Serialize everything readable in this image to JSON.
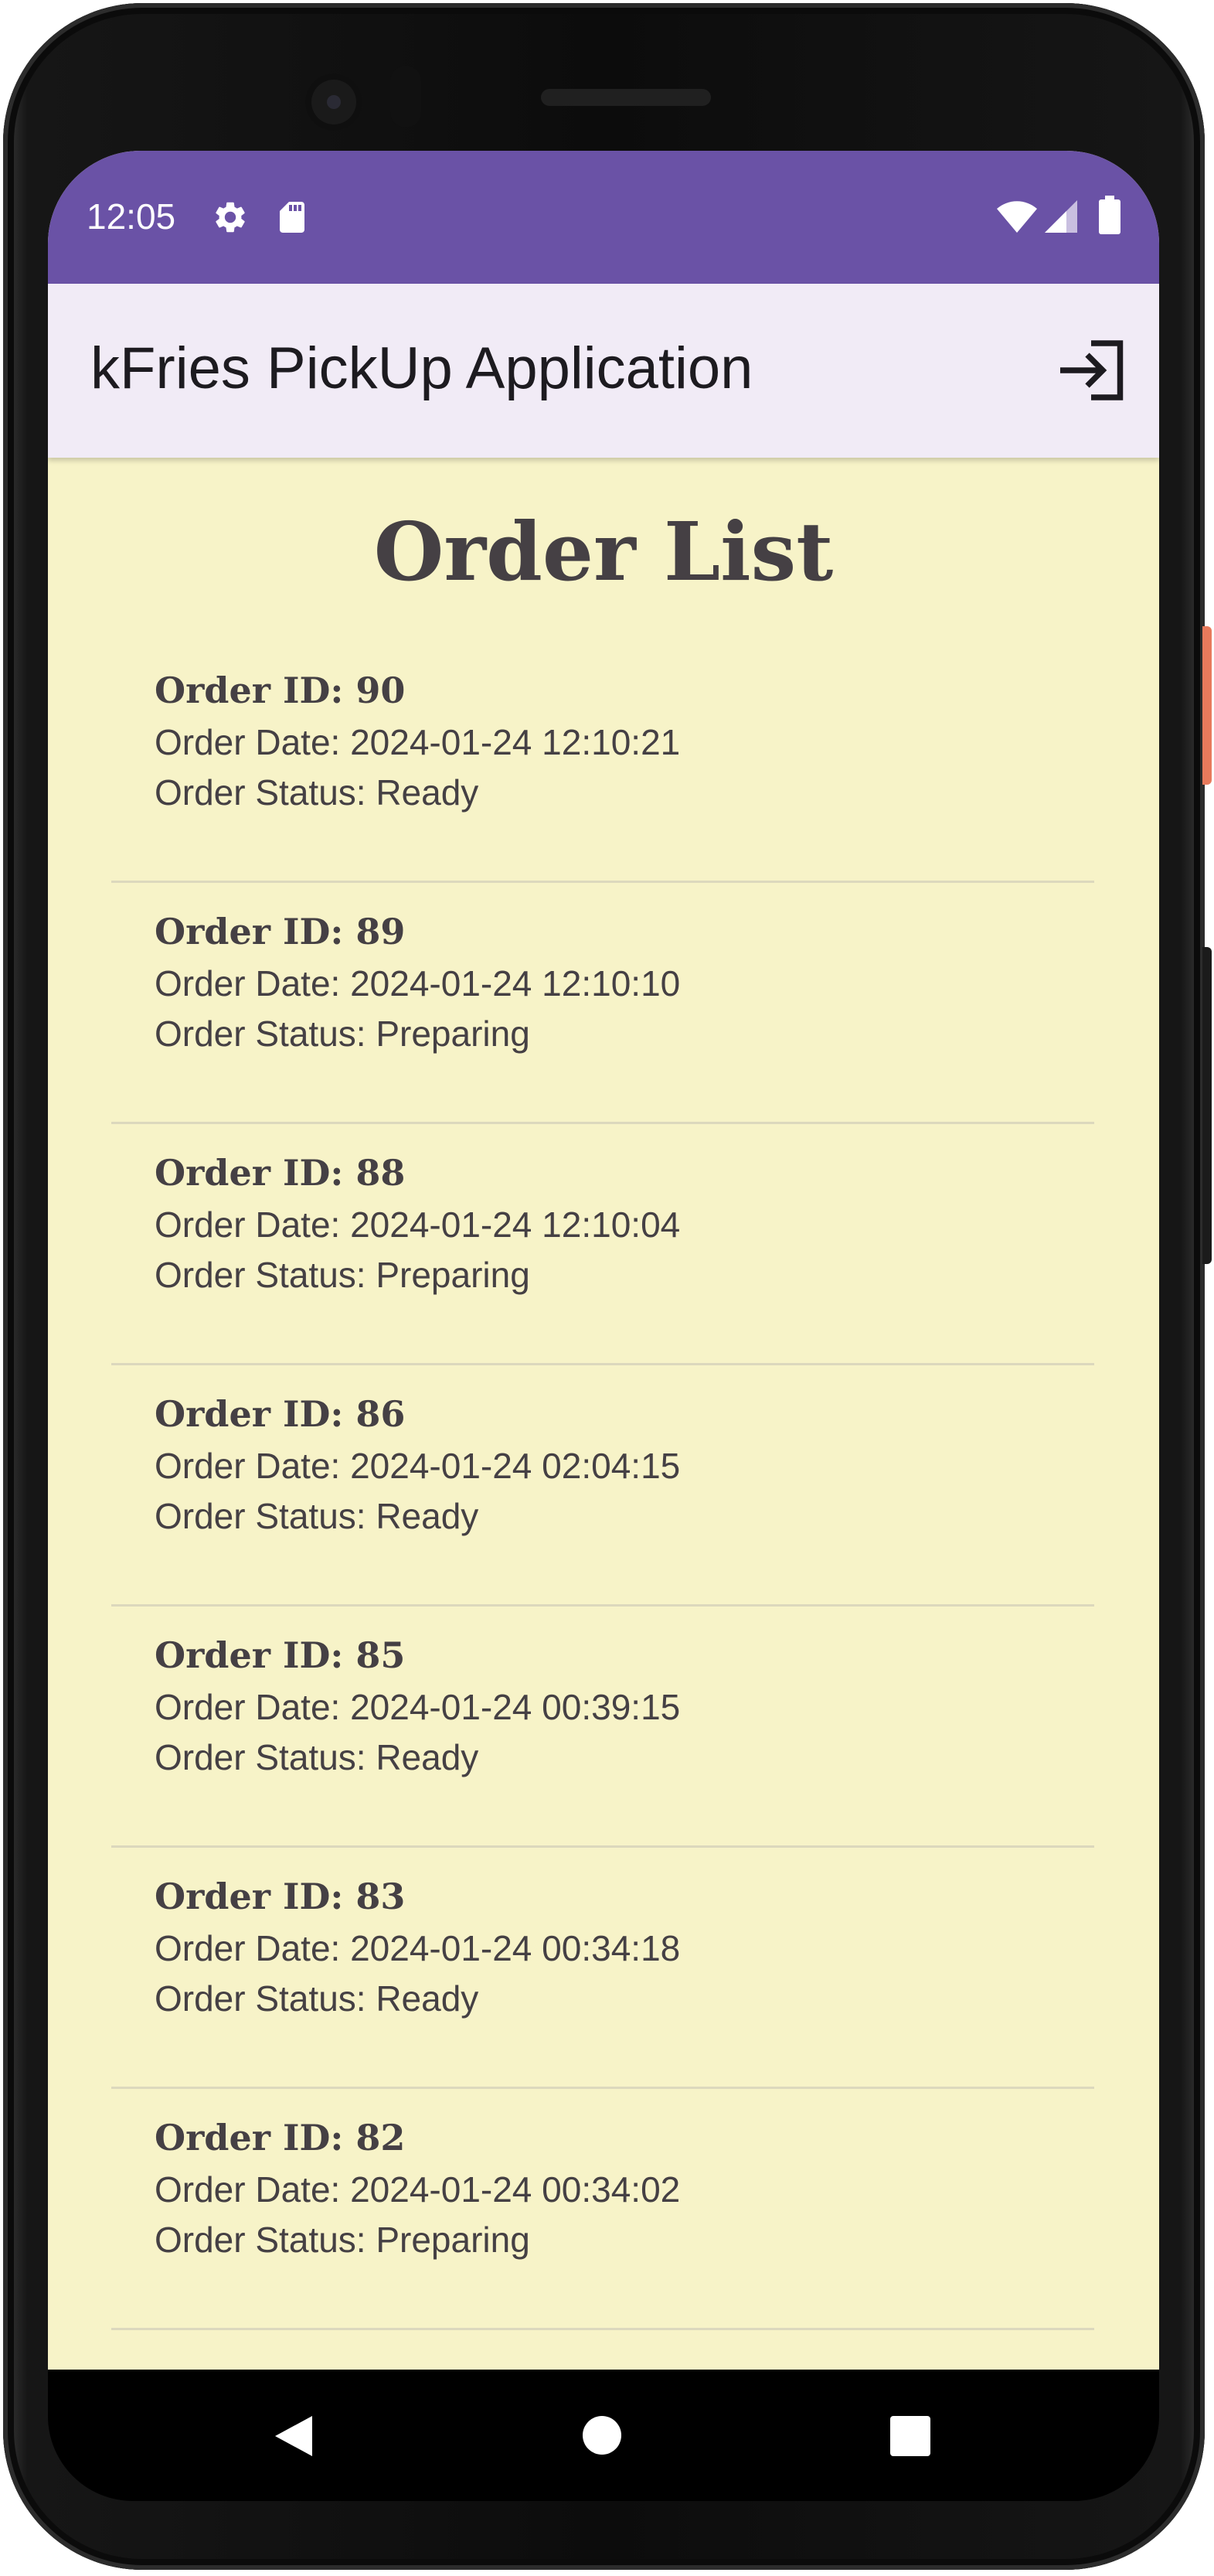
{
  "status_bar": {
    "time": "12:05",
    "left_icons": [
      "gear-icon",
      "sd-card-icon"
    ],
    "right_icons": [
      "wifi-icon",
      "cell-signal-icon",
      "battery-icon"
    ]
  },
  "app_bar": {
    "title": "kFries PickUp Application",
    "action_icon": "logout-icon"
  },
  "page": {
    "title": "Order List"
  },
  "orders": [
    {
      "id": "Order ID: 90",
      "date": "Order Date: 2024-01-24 12:10:21",
      "status": "Order Status: Ready"
    },
    {
      "id": "Order ID: 89",
      "date": "Order Date: 2024-01-24 12:10:10",
      "status": "Order Status: Preparing"
    },
    {
      "id": "Order ID: 88",
      "date": "Order Date: 2024-01-24 12:10:04",
      "status": "Order Status: Preparing"
    },
    {
      "id": "Order ID: 86",
      "date": "Order Date: 2024-01-24 02:04:15",
      "status": "Order Status: Ready"
    },
    {
      "id": "Order ID: 85",
      "date": "Order Date: 2024-01-24 00:39:15",
      "status": "Order Status: Ready"
    },
    {
      "id": "Order ID: 83",
      "date": "Order Date: 2024-01-24 00:34:18",
      "status": "Order Status: Ready"
    },
    {
      "id": "Order ID: 82",
      "date": "Order Date: 2024-01-24 00:34:02",
      "status": "Order Status: Preparing"
    }
  ],
  "nav_bar": {
    "icons": [
      "back-triangle-icon",
      "home-circle-icon",
      "recents-square-icon"
    ]
  },
  "colors": {
    "status_bar": "#6a52a6",
    "app_bar": "#f1ebf6",
    "background": "#f7f3c8",
    "text": "#454044",
    "divider": "#dcd8bd"
  }
}
